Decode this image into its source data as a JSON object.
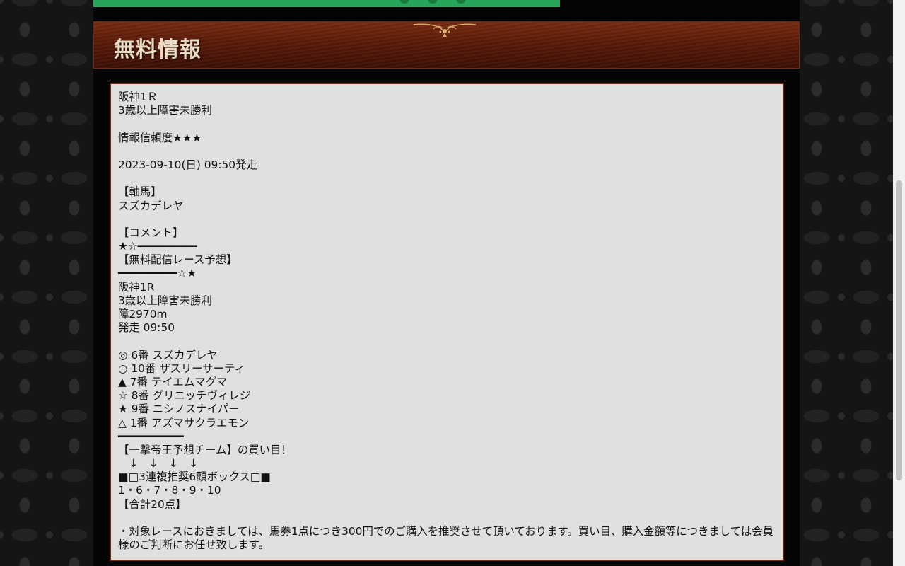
{
  "section": {
    "title": "無料情報"
  },
  "post": {
    "lines": [
      "阪神1Ｒ",
      "3歳以上障害未勝利",
      "",
      "情報信頼度★★★",
      "",
      "2023-09-10(日) 09:50発走",
      "",
      "【軸馬】",
      "スズカデレヤ",
      "",
      "【コメント】",
      "★☆━━━━━━━━━",
      "【無料配信レース予想】",
      "━━━━━━━━━☆★",
      "阪神1R",
      "3歳以上障害未勝利",
      "障2970m",
      "発走 09:50",
      "",
      "◎ 6番 スズカデレヤ",
      "○ 10番 ザスリーサーティ",
      "▲ 7番 テイエムマグマ",
      "☆ 8番 グリニッチヴィレジ",
      "★ 9番 ニシノスナイパー",
      "△ 1番 アズマサクラエモン",
      "━━━━━━━━━━",
      "【一撃帝王予想チーム】の買い目！",
      "　↓　↓　↓　↓",
      "■□3連複推奨6頭ボックス□■",
      "1・6・7・8・9・10",
      "【合計20点】",
      "",
      "・対象レースにおきましては、馬券1点につき300円でのご購入を推奨させて頂いております。買い目、購入金額等につきましては会員様のご判断にお任せ致します。"
    ]
  },
  "scrollbar": {
    "position_fraction": 0.32
  }
}
